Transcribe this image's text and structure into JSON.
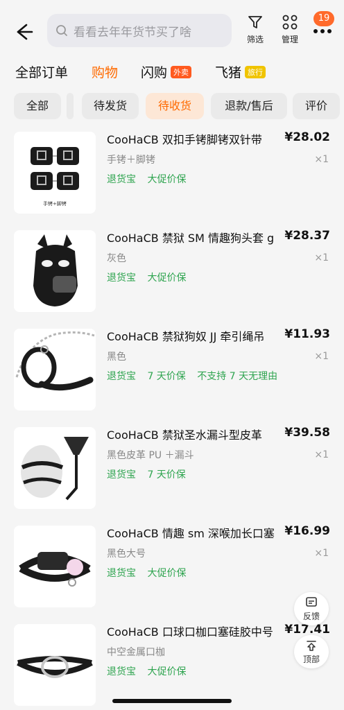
{
  "header": {
    "search_placeholder": "看看去年年货节买了啥",
    "filter_label": "筛选",
    "manage_label": "管理",
    "badge_count": "19"
  },
  "tabs": [
    {
      "label": "全部订单"
    },
    {
      "label": "购物",
      "active": true
    },
    {
      "label": "闪购",
      "tag": "外卖"
    },
    {
      "label": "飞猪",
      "tag": "旅行"
    }
  ],
  "filters": [
    {
      "label": "全部"
    },
    {
      "label": "待发货"
    },
    {
      "label": "待收货",
      "active": true
    },
    {
      "label": "退款/售后"
    },
    {
      "label": "评价"
    }
  ],
  "orders": [
    {
      "title": "CooHaCB 双扣手铐脚铐双针带",
      "price": "¥28.02",
      "spec": "手铐＋脚铐",
      "qty": "×1",
      "tags": [
        "退货宝",
        "大促价保"
      ],
      "image_caption": "手铐+脚铐"
    },
    {
      "title": "CooHaCB 禁狱 SM 情趣狗头套 g",
      "price": "¥28.37",
      "spec": "灰色",
      "qty": "×1",
      "tags": [
        "退货宝",
        "大促价保"
      ]
    },
    {
      "title": "CooHaCB 禁狱狗奴 JJ 牵引绳吊",
      "price": "¥11.93",
      "spec": "黑色",
      "qty": "×1",
      "tags": [
        "退货宝",
        "7 天价保",
        "不支持 7 天无理由"
      ]
    },
    {
      "title": "CooHaCB 禁狱圣水漏斗型皮革",
      "price": "¥39.58",
      "spec": "黑色皮革 PU ＋漏斗",
      "qty": "×1",
      "tags": [
        "退货宝",
        "7 天价保"
      ]
    },
    {
      "title": "CooHaCB 情趣 sm 深喉加长口塞",
      "price": "¥16.99",
      "spec": "黑色大号",
      "qty": "×1",
      "tags": [
        "退货宝",
        "大促价保"
      ]
    },
    {
      "title": "CooHaCB 口球口枷口塞硅胶中号",
      "price": "¥17.41",
      "spec": "中空金属口枷",
      "qty": "",
      "tags": [
        "退货宝",
        "大促价保"
      ]
    }
  ],
  "floating": {
    "feedback_label": "反馈",
    "top_label": "顶部"
  },
  "colors": {
    "accent": "#ff6a00",
    "badge": "#ff6a2b",
    "tag_green": "#2ea44f",
    "takeout_tag": "#ff5a1f",
    "travel_tag": "#f0c400"
  }
}
